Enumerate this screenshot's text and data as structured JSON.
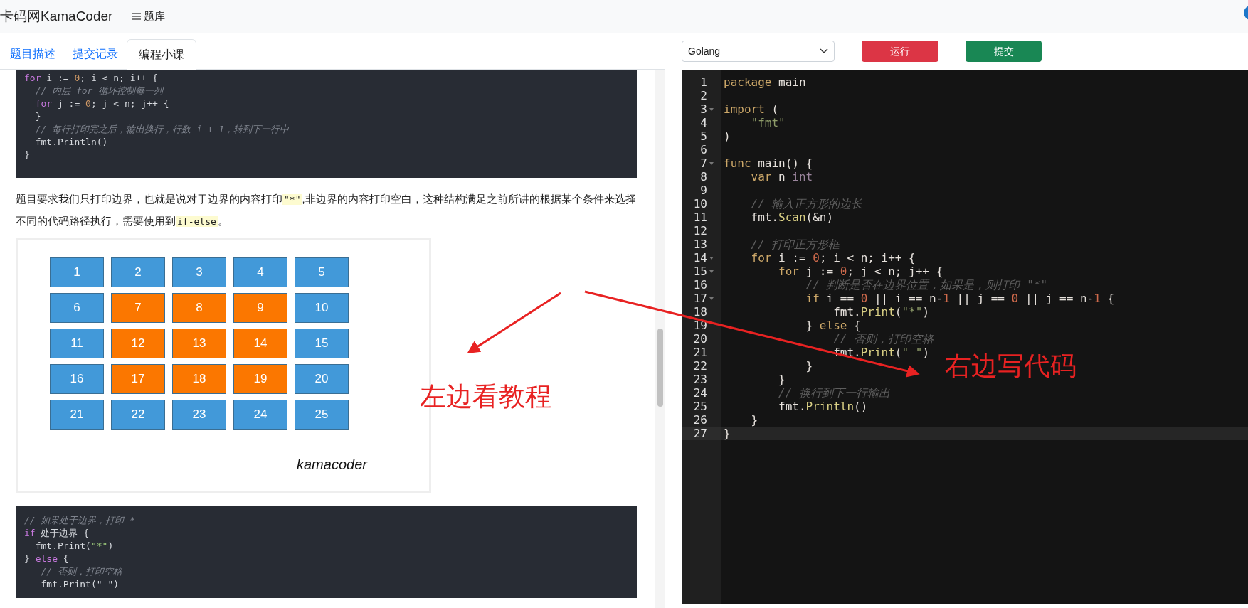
{
  "header": {
    "brand": "卡码网KamaCoder",
    "menu": "题库"
  },
  "tabs": [
    {
      "label": "题目描述",
      "selected": false
    },
    {
      "label": "提交记录",
      "selected": false
    },
    {
      "label": "编程小课",
      "selected": true
    }
  ],
  "tutorial": {
    "code_block_1": [
      [
        {
          "kind": "kw",
          "text": "for"
        },
        {
          "kind": "p",
          "text": " i := "
        },
        {
          "kind": "num",
          "text": "0"
        },
        {
          "kind": "p",
          "text": "; i < n; i++ {"
        }
      ],
      [
        {
          "kind": "cm",
          "text": "  // 内层 for 循环控制每一列"
        }
      ],
      [
        {
          "kind": "kw",
          "text": "  for"
        },
        {
          "kind": "p",
          "text": " j := "
        },
        {
          "kind": "num",
          "text": "0"
        },
        {
          "kind": "p",
          "text": "; j < n; j++ {"
        }
      ],
      [
        {
          "kind": "p",
          "text": "  }"
        }
      ],
      [
        {
          "kind": "cm",
          "text": "  // 每行打印完之后，输出换行，行数 i + 1，转到下一行中"
        }
      ],
      [
        {
          "kind": "p",
          "text": "  fmt.Println()"
        }
      ],
      [
        {
          "kind": "p",
          "text": "}"
        }
      ]
    ],
    "paragraph": [
      {
        "kind": "text",
        "text": "题目要求我们只打印边界，也就是说对于边界的内容打印"
      },
      {
        "kind": "code",
        "text": "\"*\""
      },
      {
        "kind": "text",
        "text": ",非边界的内容打印空白，这种结构满足之前所讲的根据某个条件来选择不同的代码路径执行，需要使用到"
      },
      {
        "kind": "code",
        "text": "if-else"
      },
      {
        "kind": "text",
        "text": "。"
      }
    ],
    "figure": {
      "tiles": [
        {
          "label": "1",
          "color": "#4299d9"
        },
        {
          "label": "2",
          "color": "#4299d9"
        },
        {
          "label": "3",
          "color": "#4299d9"
        },
        {
          "label": "4",
          "color": "#4299d9"
        },
        {
          "label": "5",
          "color": "#4299d9"
        },
        {
          "label": "6",
          "color": "#4299d9"
        },
        {
          "label": "7",
          "color": "#fb7700"
        },
        {
          "label": "8",
          "color": "#fb7700"
        },
        {
          "label": "9",
          "color": "#fb7700"
        },
        {
          "label": "10",
          "color": "#4299d9"
        },
        {
          "label": "11",
          "color": "#4299d9"
        },
        {
          "label": "12",
          "color": "#fb7700"
        },
        {
          "label": "13",
          "color": "#fb7700"
        },
        {
          "label": "14",
          "color": "#fb7700"
        },
        {
          "label": "15",
          "color": "#4299d9"
        },
        {
          "label": "16",
          "color": "#4299d9"
        },
        {
          "label": "17",
          "color": "#fb7700"
        },
        {
          "label": "18",
          "color": "#fb7700"
        },
        {
          "label": "19",
          "color": "#fb7700"
        },
        {
          "label": "20",
          "color": "#4299d9"
        },
        {
          "label": "21",
          "color": "#4299d9"
        },
        {
          "label": "22",
          "color": "#4299d9"
        },
        {
          "label": "23",
          "color": "#4299d9"
        },
        {
          "label": "24",
          "color": "#4299d9"
        },
        {
          "label": "25",
          "color": "#4299d9"
        }
      ],
      "caption": "kamacoder"
    },
    "code_block_2": [
      [
        {
          "kind": "cm",
          "text": "// 如果处于边界，打印 *"
        }
      ],
      [
        {
          "kind": "kw",
          "text": "if"
        },
        {
          "kind": "p",
          "text": " 处于边界 {"
        }
      ],
      [
        {
          "kind": "p",
          "text": "  fmt.Print("
        },
        {
          "kind": "str",
          "text": "\"*\""
        },
        {
          "kind": "p",
          "text": ")"
        }
      ],
      [
        {
          "kind": "p",
          "text": "} "
        },
        {
          "kind": "kw",
          "text": "else"
        },
        {
          "kind": "p",
          "text": " {"
        }
      ],
      [
        {
          "kind": "cm",
          "text": "   // 否则，打印空格"
        }
      ],
      [
        {
          "kind": "p",
          "text": "   fmt.Print(\" \")"
        }
      ]
    ]
  },
  "editor": {
    "language": "Golang",
    "run_button": "运行",
    "submit_button": "提交",
    "lines": [
      {
        "number": "1",
        "foldable": false,
        "active": false,
        "tokens": [
          {
            "kind": "kw",
            "text": "package"
          },
          {
            "kind": "p",
            "text": " main"
          }
        ]
      },
      {
        "number": "2",
        "foldable": false,
        "active": false
      },
      {
        "number": "3",
        "foldable": true,
        "active": false,
        "tokens": [
          {
            "kind": "kw",
            "text": "import"
          },
          {
            "kind": "p",
            "text": " ("
          }
        ]
      },
      {
        "number": "4",
        "foldable": false,
        "active": false,
        "tokens": [
          {
            "kind": "str",
            "text": "    \"fmt\""
          }
        ]
      },
      {
        "number": "5",
        "foldable": false,
        "active": false,
        "tokens": [
          {
            "kind": "p",
            "text": ")"
          }
        ]
      },
      {
        "number": "6",
        "foldable": false,
        "active": false
      },
      {
        "number": "7",
        "foldable": true,
        "active": false,
        "tokens": [
          {
            "kind": "kw",
            "text": "func"
          },
          {
            "kind": "p",
            "text": " main() {"
          }
        ]
      },
      {
        "number": "8",
        "foldable": false,
        "active": false,
        "tokens": [
          {
            "kind": "kw",
            "text": "    var"
          },
          {
            "kind": "p",
            "text": " n "
          },
          {
            "kind": "type",
            "text": "int"
          }
        ]
      },
      {
        "number": "9",
        "foldable": false,
        "active": false
      },
      {
        "number": "10",
        "foldable": false,
        "active": false,
        "tokens": [
          {
            "kind": "cm",
            "text": "    // 输入正方形的边长"
          }
        ]
      },
      {
        "number": "11",
        "foldable": false,
        "active": false,
        "tokens": [
          {
            "kind": "p",
            "text": "    fmt."
          },
          {
            "kind": "fn",
            "text": "Scan"
          },
          {
            "kind": "p",
            "text": "(&n)"
          }
        ]
      },
      {
        "number": "12",
        "foldable": false,
        "active": false
      },
      {
        "number": "13",
        "foldable": false,
        "active": false,
        "tokens": [
          {
            "kind": "cm",
            "text": "    // 打印正方形框"
          }
        ]
      },
      {
        "number": "14",
        "foldable": true,
        "active": false,
        "tokens": [
          {
            "kind": "kw",
            "text": "    for"
          },
          {
            "kind": "p",
            "text": " i := "
          },
          {
            "kind": "num",
            "text": "0"
          },
          {
            "kind": "p",
            "text": "; i < n; i++ {"
          }
        ]
      },
      {
        "number": "15",
        "foldable": true,
        "active": false,
        "tokens": [
          {
            "kind": "kw",
            "text": "        for"
          },
          {
            "kind": "p",
            "text": " j := "
          },
          {
            "kind": "num",
            "text": "0"
          },
          {
            "kind": "p",
            "text": "; j < n; j++ {"
          }
        ]
      },
      {
        "number": "16",
        "foldable": false,
        "active": false,
        "tokens": [
          {
            "kind": "cm",
            "text": "            // 判断是否在边界位置，如果是，则打印 \"*\""
          }
        ]
      },
      {
        "number": "17",
        "foldable": true,
        "active": false,
        "tokens": [
          {
            "kind": "kw",
            "text": "            if"
          },
          {
            "kind": "p",
            "text": " i == "
          },
          {
            "kind": "num",
            "text": "0"
          },
          {
            "kind": "p",
            "text": " || i == n-"
          },
          {
            "kind": "num",
            "text": "1"
          },
          {
            "kind": "p",
            "text": " || j == "
          },
          {
            "kind": "num",
            "text": "0"
          },
          {
            "kind": "p",
            "text": " || j == n-"
          },
          {
            "kind": "num",
            "text": "1"
          },
          {
            "kind": "p",
            "text": " {"
          }
        ]
      },
      {
        "number": "18",
        "foldable": false,
        "active": false,
        "tokens": [
          {
            "kind": "p",
            "text": "                fmt."
          },
          {
            "kind": "fn",
            "text": "Print"
          },
          {
            "kind": "p",
            "text": "("
          },
          {
            "kind": "str",
            "text": "\"*\""
          },
          {
            "kind": "p",
            "text": ")"
          }
        ]
      },
      {
        "number": "19",
        "foldable": false,
        "active": false,
        "tokens": [
          {
            "kind": "p",
            "text": "            } "
          },
          {
            "kind": "kw",
            "text": "else"
          },
          {
            "kind": "p",
            "text": " {"
          }
        ]
      },
      {
        "number": "20",
        "foldable": false,
        "active": false,
        "tokens": [
          {
            "kind": "cm",
            "text": "                // 否则，打印空格"
          }
        ]
      },
      {
        "number": "21",
        "foldable": false,
        "active": false,
        "tokens": [
          {
            "kind": "p",
            "text": "                fmt."
          },
          {
            "kind": "fn",
            "text": "Print"
          },
          {
            "kind": "p",
            "text": "("
          },
          {
            "kind": "str",
            "text": "\" \""
          },
          {
            "kind": "p",
            "text": ")"
          }
        ]
      },
      {
        "number": "22",
        "foldable": false,
        "active": false,
        "tokens": [
          {
            "kind": "p",
            "text": "            }"
          }
        ]
      },
      {
        "number": "23",
        "foldable": false,
        "active": false,
        "tokens": [
          {
            "kind": "p",
            "text": "        }"
          }
        ]
      },
      {
        "number": "24",
        "foldable": false,
        "active": false,
        "tokens": [
          {
            "kind": "cm",
            "text": "        // 换行到下一行输出"
          }
        ]
      },
      {
        "number": "25",
        "foldable": false,
        "active": false,
        "tokens": [
          {
            "kind": "p",
            "text": "        fmt."
          },
          {
            "kind": "fn",
            "text": "Println"
          },
          {
            "kind": "p",
            "text": "()"
          }
        ]
      },
      {
        "number": "26",
        "foldable": false,
        "active": false,
        "tokens": [
          {
            "kind": "p",
            "text": "    }"
          }
        ]
      },
      {
        "number": "27",
        "foldable": false,
        "active": true,
        "tokens": [
          {
            "kind": "p",
            "text": "}"
          }
        ]
      }
    ]
  },
  "annotations": [
    {
      "text": "左边看教程"
    },
    {
      "text": "右边写代码"
    }
  ]
}
